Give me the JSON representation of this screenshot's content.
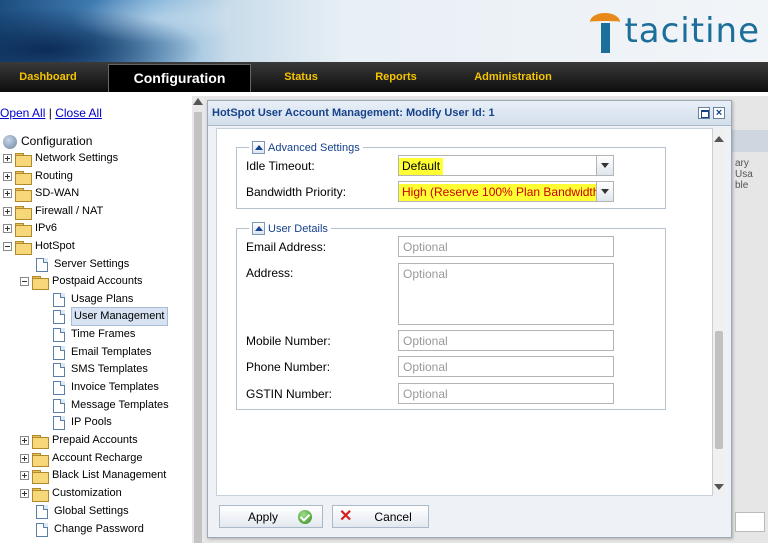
{
  "brand": {
    "logo_text": "tacitine"
  },
  "nav": {
    "items": [
      {
        "label": "Dashboard"
      },
      {
        "label": "Configuration"
      },
      {
        "label": "Status"
      },
      {
        "label": "Reports"
      },
      {
        "label": "Administration"
      }
    ],
    "active": "Configuration"
  },
  "sidebar": {
    "open_all": "Open All",
    "separator": "|",
    "close_all": "Close All",
    "root": "Configuration",
    "tree": [
      {
        "label": "Network Settings"
      },
      {
        "label": "Routing"
      },
      {
        "label": "SD-WAN"
      },
      {
        "label": "Firewall / NAT"
      },
      {
        "label": "IPv6"
      },
      {
        "label": "HotSpot"
      },
      {
        "label": "Server Settings"
      },
      {
        "label": "Postpaid Accounts"
      },
      {
        "label": "Usage Plans"
      },
      {
        "label": "User Management"
      },
      {
        "label": "Time Frames"
      },
      {
        "label": "Email Templates"
      },
      {
        "label": "SMS Templates"
      },
      {
        "label": "Invoice Templates"
      },
      {
        "label": "Message Templates"
      },
      {
        "label": "IP Pools"
      },
      {
        "label": "Prepaid Accounts"
      },
      {
        "label": "Account Recharge"
      },
      {
        "label": "Black List Management"
      },
      {
        "label": "Customization"
      },
      {
        "label": "Global Settings"
      },
      {
        "label": "Change Password"
      }
    ],
    "selected": "User Management"
  },
  "background": {
    "col_fragment_1": "ary Usa",
    "col_fragment_2": "ble"
  },
  "dialog": {
    "title": "HotSpot User Account Management: Modify User Id: 1",
    "advanced": {
      "legend": "Advanced Settings",
      "idle_timeout_label": "Idle Timeout:",
      "idle_timeout_value": "Default",
      "bandwidth_label": "Bandwidth Priority:",
      "bandwidth_value": "High (Reserve 100% Plan Bandwidth"
    },
    "user_details": {
      "legend": "User Details",
      "email_label": "Email Address:",
      "email_placeholder": "Optional",
      "address_label": "Address:",
      "address_placeholder": "Optional",
      "mobile_label": "Mobile Number:",
      "mobile_placeholder": "Optional",
      "phone_label": "Phone Number:",
      "phone_placeholder": "Optional",
      "gstin_label": "GSTIN Number:",
      "gstin_placeholder": "Optional"
    },
    "buttons": {
      "apply": "Apply",
      "cancel": "Cancel"
    }
  },
  "colors": {
    "highlight": "#ffff33",
    "nav_text": "#f5c400",
    "title_text": "#15428b",
    "brand": "#1b6f9a",
    "brand_accent": "#e88a1a"
  }
}
